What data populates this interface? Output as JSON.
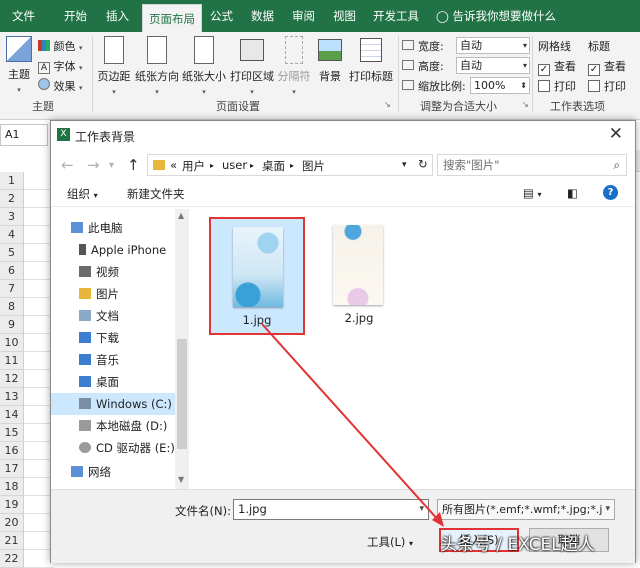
{
  "menu": {
    "tabs": [
      "文件",
      "开始",
      "插入",
      "页面布局",
      "公式",
      "数据",
      "审阅",
      "视图",
      "开发工具"
    ],
    "active_tab": "页面布局",
    "tell_me": "告诉我你想要做什么"
  },
  "ribbon": {
    "themes": {
      "label": "主题",
      "colors": "颜色",
      "fonts": "字体",
      "effects": "效果",
      "group": "主题"
    },
    "page_setup": {
      "margins": "页边距",
      "orientation": "纸张方向",
      "size": "纸张大小",
      "print_area": "打印区域",
      "breaks": "分隔符",
      "background": "背景",
      "print_titles": "打印标题",
      "group": "页面设置"
    },
    "scale": {
      "width_label": "宽度:",
      "width_value": "自动",
      "height_label": "高度:",
      "height_value": "自动",
      "scale_label": "缩放比例:",
      "scale_value": "100%",
      "group": "调整为合适大小"
    },
    "sheet_options": {
      "gridlines": "网格线",
      "headings": "标题",
      "view": "查看",
      "print": "打印",
      "group": "工作表选项"
    }
  },
  "name_box": "A1",
  "rows": [
    "1",
    "2",
    "3",
    "4",
    "5",
    "6",
    "7",
    "8",
    "9",
    "10",
    "11",
    "12",
    "13",
    "14",
    "15",
    "16",
    "17",
    "18",
    "19",
    "20",
    "21",
    "22"
  ],
  "dialog": {
    "title": "工作表背景",
    "path": {
      "prefix": "«",
      "parts": [
        "用户",
        "user",
        "桌面",
        "图片"
      ]
    },
    "search_placeholder": "搜索\"图片\"",
    "organize": "组织",
    "new_folder": "新建文件夹",
    "nav_items": [
      "此电脑",
      "Apple iPhone",
      "视频",
      "图片",
      "文档",
      "下载",
      "音乐",
      "桌面",
      "Windows (C:)",
      "本地磁盘 (D:)",
      "CD 驱动器 (E:)",
      "网络"
    ],
    "selected_nav": "Windows (C:)",
    "files": [
      "1.jpg",
      "2.jpg"
    ],
    "selected_file": "1.jpg",
    "filename_label": "文件名(N):",
    "filename_value": "1.jpg",
    "filter": "所有图片(*.emf;*.wmf;*.jpg;*.jp",
    "tools": "工具(L)",
    "insert": "插入(S)",
    "cancel": "取消"
  },
  "watermark": "头条号 / EXCEL超人",
  "colors": {
    "excel_green": "#217346",
    "highlight": "#e03333",
    "selection": "#cce8ff"
  }
}
